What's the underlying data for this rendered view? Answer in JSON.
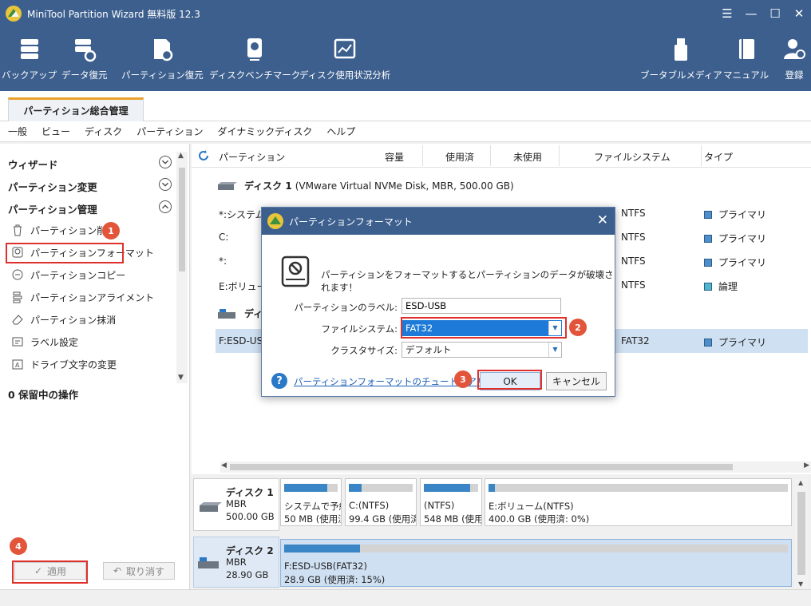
{
  "app": {
    "title": "MiniTool Partition Wizard 無料版 12.3"
  },
  "window_controls": {
    "menu": "☰",
    "minimize": "—",
    "maximize": "☐",
    "close": "✕"
  },
  "toolbar": {
    "backup": "バックアップ",
    "data_recovery": "データ復元",
    "partition_recovery": "パーティション復元",
    "disk_benchmark": "ディスクベンチマーク",
    "space_analyzer": "ディスク使用状況分析",
    "bootable_media": "ブータブルメディア",
    "manual": "マニュアル",
    "register": "登録"
  },
  "tab": {
    "label": "パーティション総合管理"
  },
  "menu": [
    "一般",
    "ビュー",
    "ディスク",
    "パーティション",
    "ダイナミックディスク",
    "ヘルプ"
  ],
  "sidebar": {
    "wizard": "ウィザード",
    "change_partition": "パーティション変更",
    "partition_management": "パーティション管理",
    "items": [
      "パーティション削除",
      "パーティションフォーマット",
      "パーティションコピー",
      "パーティションアライメント",
      "パーティション抹消",
      "ラベル設定",
      "ドライブ文字の変更"
    ],
    "pending": "0 保留中の操作",
    "apply": "適用",
    "undo": "取り消す"
  },
  "table": {
    "headers": {
      "partition": "パーティション",
      "capacity": "容量",
      "used": "使用済",
      "unused": "未使用",
      "filesystem": "ファイルシステム",
      "type": "タイプ"
    },
    "disk1": {
      "name": "ディスク 1",
      "desc": "(VMware Virtual NVMe Disk, MBR, 500.00 GB)"
    },
    "disk2": {
      "name": "ディ"
    },
    "rows": [
      {
        "name": "*:システムで",
        "fs": "NTFS",
        "type": "プライマリ"
      },
      {
        "name": "C:",
        "fs": "NTFS",
        "type": "プライマリ"
      },
      {
        "name": "*:",
        "fs": "NTFS",
        "type": "プライマリ"
      },
      {
        "name": "E:ボリューム",
        "fs": "NTFS",
        "type": "論理"
      },
      {
        "name": "F:ESD-USB",
        "fs": "FAT32",
        "type": "プライマリ"
      }
    ]
  },
  "diskmap": {
    "disk1": {
      "name": "ディスク 1",
      "style": "MBR",
      "size": "500.00 GB"
    },
    "disk1_parts": [
      {
        "l1": "システムで予約",
        "l2": "50 MB (使用済",
        "used": 0.8
      },
      {
        "l1": "C:(NTFS)",
        "l2": "99.4 GB (使用済",
        "used": 0.2
      },
      {
        "l1": "(NTFS)",
        "l2": "548 MB (使用済",
        "used": 0.85
      },
      {
        "l1": "E:ボリューム(NTFS)",
        "l2": "400.0 GB (使用済: 0%)",
        "used": 0.01
      }
    ],
    "disk2": {
      "name": "ディスク 2",
      "style": "MBR",
      "size": "28.90 GB"
    },
    "disk2_part": {
      "l1": "F:ESD-USB(FAT32)",
      "l2": "28.9 GB (使用済: 15%)",
      "used": 0.15
    }
  },
  "dialog": {
    "title": "パーティションフォーマット",
    "warning": "パーティションをフォーマットするとパーティションのデータが破壊されます！",
    "label_caption": "パーティションのラベル:",
    "label_value": "ESD-USB",
    "fs_caption": "ファイルシステム:",
    "fs_value": "FAT32",
    "cluster_caption": "クラスタサイズ:",
    "cluster_value": "デフォルト",
    "help_link": "パーティションフォーマットのチュートリアル",
    "ok": "OK",
    "cancel": "キャンセル"
  },
  "badges": [
    "1",
    "2",
    "3",
    "4"
  ]
}
